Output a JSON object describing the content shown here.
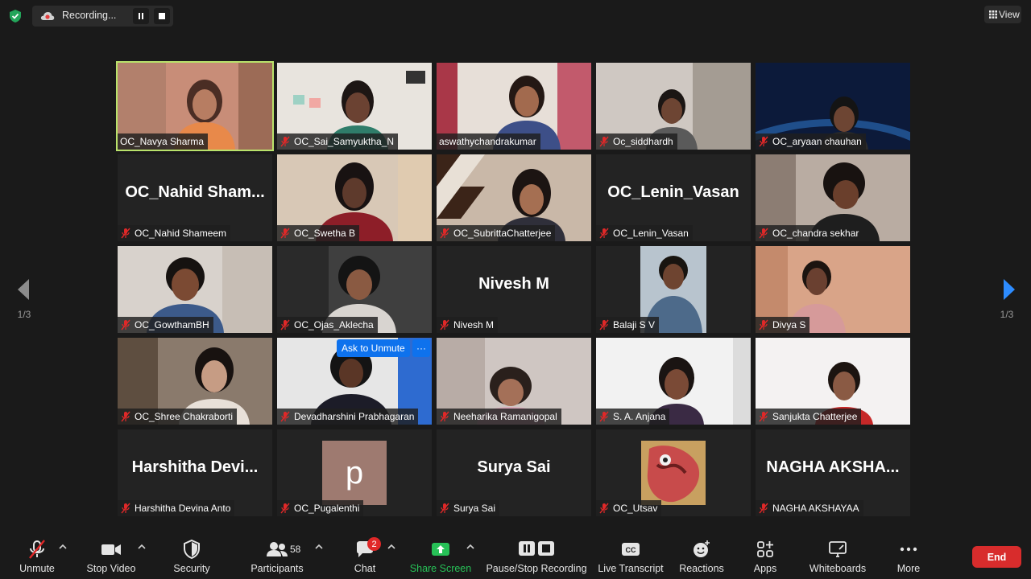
{
  "top": {
    "recording_label": "Recording...",
    "view_label": "View"
  },
  "pager": {
    "left": "1/3",
    "right": "1/3"
  },
  "tiles": [
    {
      "name": "OC_Navya Sharma",
      "muted": false,
      "active": true
    },
    {
      "name": "OC_Sai_Samyuktha_N",
      "muted": true
    },
    {
      "name": "aswathychandrakumar",
      "muted": false
    },
    {
      "name": "Oc_siddhardh",
      "muted": true
    },
    {
      "name": "OC_aryaan chauhan",
      "muted": true
    },
    {
      "name": "OC_Nahid Shameem",
      "muted": true,
      "display": "OC_Nahid  Sham..."
    },
    {
      "name": "OC_Swetha B",
      "muted": true
    },
    {
      "name": "OC_SubrittaChatterjee",
      "muted": true
    },
    {
      "name": "OC_Lenin_Vasan",
      "muted": true,
      "display": "OC_Lenin_Vasan"
    },
    {
      "name": "OC_chandra sekhar",
      "muted": true
    },
    {
      "name": "OC_GowthamBH",
      "muted": true
    },
    {
      "name": "OC_Ojas_Aklecha",
      "muted": true
    },
    {
      "name": "Nivesh M",
      "muted": true,
      "display": "Nivesh M"
    },
    {
      "name": "Balaji S V",
      "muted": true
    },
    {
      "name": "Divya S",
      "muted": true
    },
    {
      "name": "OC_Shree Chakraborti",
      "muted": true
    },
    {
      "name": "Devadharshini Prabhagaran",
      "muted": true
    },
    {
      "name": "Neeharika Ramanigopal",
      "muted": true
    },
    {
      "name": "S. A. Anjana",
      "muted": true
    },
    {
      "name": "Sanjukta Chatterjee",
      "muted": true
    },
    {
      "name": "Harshitha Devina Anto",
      "muted": true,
      "display": "Harshitha  Devi..."
    },
    {
      "name": "OC_Pugalenthi",
      "muted": true,
      "avatar_letter": "p"
    },
    {
      "name": "Surya Sai",
      "muted": true,
      "display": "Surya Sai"
    },
    {
      "name": "OC_Utsav",
      "muted": true
    },
    {
      "name": "NAGHA AKSHAYAA",
      "muted": true,
      "display": "NAGHA  AKSHA..."
    }
  ],
  "ask_unmute": {
    "label": "Ask to Unmute",
    "more": "···"
  },
  "toolbar": {
    "unmute": "Unmute",
    "stop_video": "Stop Video",
    "security": "Security",
    "participants": "Participants",
    "participants_count": "58",
    "chat": "Chat",
    "chat_badge": "2",
    "share_screen": "Share Screen",
    "pause_stop_recording": "Pause/Stop Recording",
    "live_transcript": "Live Transcript",
    "reactions": "Reactions",
    "apps": "Apps",
    "whiteboards": "Whiteboards",
    "more": "More",
    "end": "End"
  },
  "colors": {
    "accent_green": "#27c157",
    "active_border": "#b9e26b",
    "end_red": "#d82c2c",
    "mute_red": "#e02828",
    "ask_blue": "#0e72ed"
  }
}
